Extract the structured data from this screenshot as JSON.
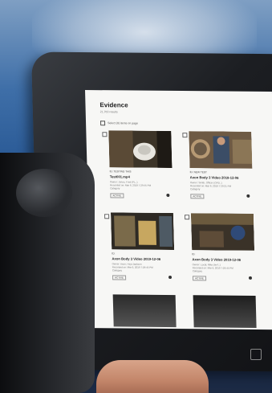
{
  "screen": {
    "title": "Evidence",
    "subtitle": "21,763 results",
    "toggle_label": "Select (0) items on page"
  },
  "cards": [
    {
      "id": "ID: TESTING THIS",
      "name": "Test001.mp4",
      "meta1": "Owner: Jones, Fred (PL..)",
      "meta2": "Recorded on: Mar 6, 2019 7:29:45 PM",
      "meta3": "Category",
      "status": "ACTIVE"
    },
    {
      "id": "ID: NEW TEST",
      "name": "Axon Body 3 Video 2019-12-06",
      "meta1": "Owner: Smith, Officer (OPD..)",
      "meta2": "Recorded on: Mar 6, 2019 7:29:21 PM",
      "meta3": "Category",
      "status": "ACTIVE"
    },
    {
      "id": "ID:",
      "name": "Axon Body 3 Video 2019-12-06",
      "meta1": "Owner: Axon, Hoyt Jackson",
      "meta2": "Recorded on: Mar 6, 2019 7:29:45 PM",
      "meta3": "Category",
      "status": "ACTIVE"
    },
    {
      "id": "ID:",
      "name": "Axon Body 3 Video 2019-12-06",
      "meta1": "Owner: Local, Mike (lm-f..)",
      "meta2": "Recorded on: Mar 6, 2019 7:29:45 PM",
      "meta3": "Category",
      "status": "ACTIVE"
    }
  ]
}
